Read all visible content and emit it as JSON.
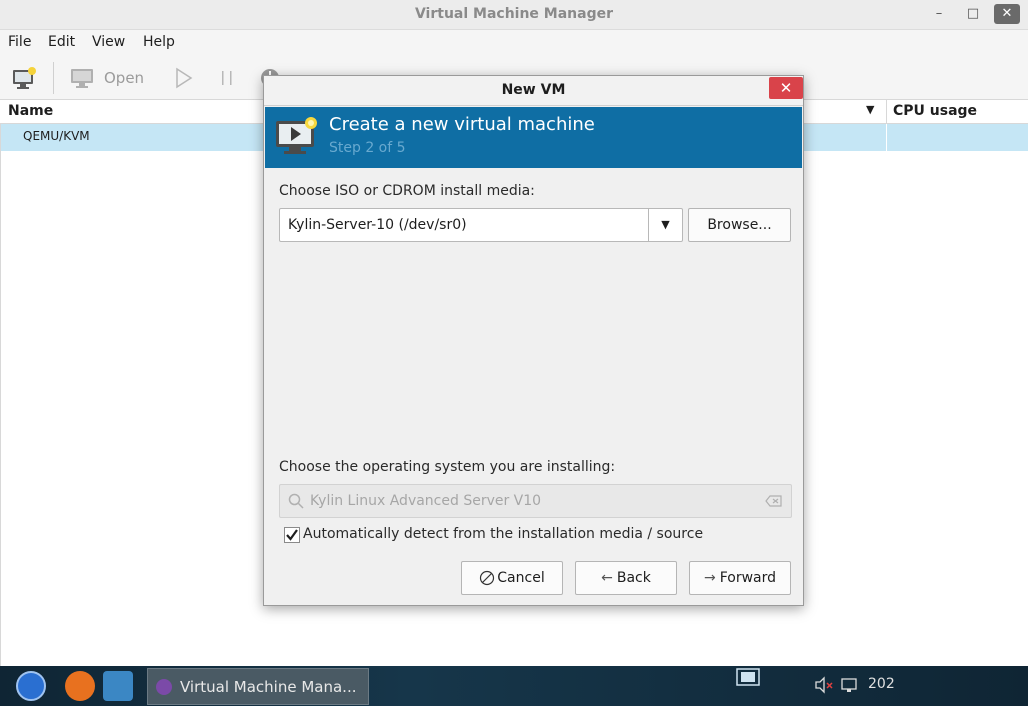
{
  "window": {
    "title": "Virtual Machine Manager",
    "controls": {
      "minimize": "–",
      "maximize": "□",
      "close": "✕"
    }
  },
  "menu": [
    "File",
    "Edit",
    "View",
    "Help"
  ],
  "toolbar": {
    "open_label": "Open"
  },
  "list": {
    "col_name": "Name",
    "col_cpu": "CPU usage",
    "rows": [
      {
        "name": "QEMU/KVM"
      }
    ]
  },
  "dialog": {
    "title": "New VM",
    "close_glyph": "✕",
    "header_title": "Create a new virtual machine",
    "header_step": "Step 2 of 5",
    "media_label": "Choose ISO or CDROM install media:",
    "media_value": "Kylin-Server-10 (/dev/sr0)",
    "browse_label": "Browse...",
    "os_label": "Choose the operating system you are installing:",
    "os_placeholder": "Kylin Linux Advanced Server V10",
    "autodetect_label": "Automatically detect from the installation media / source",
    "autodetect_checked": true,
    "cancel_label": "Cancel",
    "back_label": "Back",
    "forward_label": "Forward"
  },
  "taskbar": {
    "task_label": "Virtual Machine Mana...",
    "clock": "202"
  },
  "colors": {
    "banner": "#0f6ea4",
    "selection": "#c5e6f5",
    "close_red": "#d9434a",
    "taskbar": "#0f2534"
  }
}
